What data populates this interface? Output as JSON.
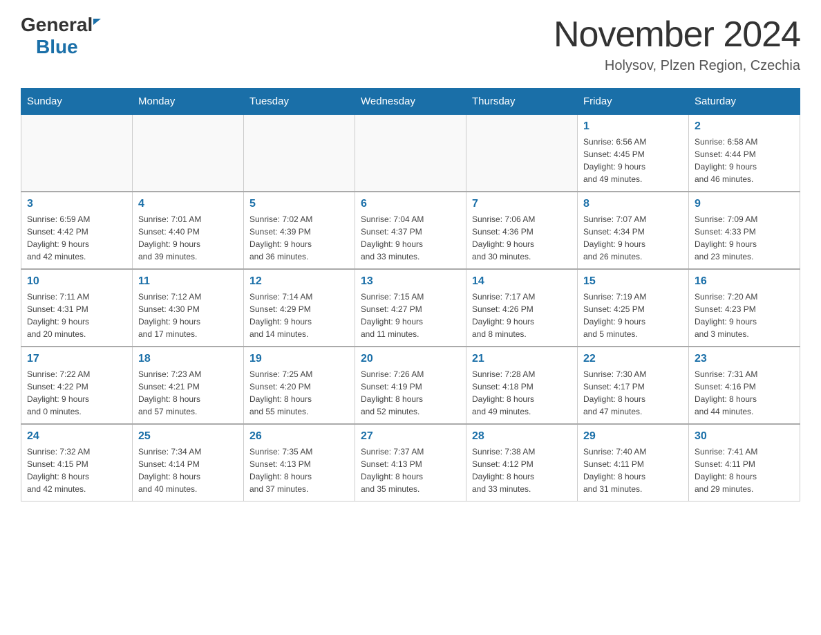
{
  "header": {
    "logo_line1": "General",
    "logo_line2": "Blue",
    "month_title": "November 2024",
    "location": "Holysov, Plzen Region, Czechia"
  },
  "weekdays": [
    "Sunday",
    "Monday",
    "Tuesday",
    "Wednesday",
    "Thursday",
    "Friday",
    "Saturday"
  ],
  "rows": [
    [
      {
        "day": "",
        "info": ""
      },
      {
        "day": "",
        "info": ""
      },
      {
        "day": "",
        "info": ""
      },
      {
        "day": "",
        "info": ""
      },
      {
        "day": "",
        "info": ""
      },
      {
        "day": "1",
        "info": "Sunrise: 6:56 AM\nSunset: 4:45 PM\nDaylight: 9 hours\nand 49 minutes."
      },
      {
        "day": "2",
        "info": "Sunrise: 6:58 AM\nSunset: 4:44 PM\nDaylight: 9 hours\nand 46 minutes."
      }
    ],
    [
      {
        "day": "3",
        "info": "Sunrise: 6:59 AM\nSunset: 4:42 PM\nDaylight: 9 hours\nand 42 minutes."
      },
      {
        "day": "4",
        "info": "Sunrise: 7:01 AM\nSunset: 4:40 PM\nDaylight: 9 hours\nand 39 minutes."
      },
      {
        "day": "5",
        "info": "Sunrise: 7:02 AM\nSunset: 4:39 PM\nDaylight: 9 hours\nand 36 minutes."
      },
      {
        "day": "6",
        "info": "Sunrise: 7:04 AM\nSunset: 4:37 PM\nDaylight: 9 hours\nand 33 minutes."
      },
      {
        "day": "7",
        "info": "Sunrise: 7:06 AM\nSunset: 4:36 PM\nDaylight: 9 hours\nand 30 minutes."
      },
      {
        "day": "8",
        "info": "Sunrise: 7:07 AM\nSunset: 4:34 PM\nDaylight: 9 hours\nand 26 minutes."
      },
      {
        "day": "9",
        "info": "Sunrise: 7:09 AM\nSunset: 4:33 PM\nDaylight: 9 hours\nand 23 minutes."
      }
    ],
    [
      {
        "day": "10",
        "info": "Sunrise: 7:11 AM\nSunset: 4:31 PM\nDaylight: 9 hours\nand 20 minutes."
      },
      {
        "day": "11",
        "info": "Sunrise: 7:12 AM\nSunset: 4:30 PM\nDaylight: 9 hours\nand 17 minutes."
      },
      {
        "day": "12",
        "info": "Sunrise: 7:14 AM\nSunset: 4:29 PM\nDaylight: 9 hours\nand 14 minutes."
      },
      {
        "day": "13",
        "info": "Sunrise: 7:15 AM\nSunset: 4:27 PM\nDaylight: 9 hours\nand 11 minutes."
      },
      {
        "day": "14",
        "info": "Sunrise: 7:17 AM\nSunset: 4:26 PM\nDaylight: 9 hours\nand 8 minutes."
      },
      {
        "day": "15",
        "info": "Sunrise: 7:19 AM\nSunset: 4:25 PM\nDaylight: 9 hours\nand 5 minutes."
      },
      {
        "day": "16",
        "info": "Sunrise: 7:20 AM\nSunset: 4:23 PM\nDaylight: 9 hours\nand 3 minutes."
      }
    ],
    [
      {
        "day": "17",
        "info": "Sunrise: 7:22 AM\nSunset: 4:22 PM\nDaylight: 9 hours\nand 0 minutes."
      },
      {
        "day": "18",
        "info": "Sunrise: 7:23 AM\nSunset: 4:21 PM\nDaylight: 8 hours\nand 57 minutes."
      },
      {
        "day": "19",
        "info": "Sunrise: 7:25 AM\nSunset: 4:20 PM\nDaylight: 8 hours\nand 55 minutes."
      },
      {
        "day": "20",
        "info": "Sunrise: 7:26 AM\nSunset: 4:19 PM\nDaylight: 8 hours\nand 52 minutes."
      },
      {
        "day": "21",
        "info": "Sunrise: 7:28 AM\nSunset: 4:18 PM\nDaylight: 8 hours\nand 49 minutes."
      },
      {
        "day": "22",
        "info": "Sunrise: 7:30 AM\nSunset: 4:17 PM\nDaylight: 8 hours\nand 47 minutes."
      },
      {
        "day": "23",
        "info": "Sunrise: 7:31 AM\nSunset: 4:16 PM\nDaylight: 8 hours\nand 44 minutes."
      }
    ],
    [
      {
        "day": "24",
        "info": "Sunrise: 7:32 AM\nSunset: 4:15 PM\nDaylight: 8 hours\nand 42 minutes."
      },
      {
        "day": "25",
        "info": "Sunrise: 7:34 AM\nSunset: 4:14 PM\nDaylight: 8 hours\nand 40 minutes."
      },
      {
        "day": "26",
        "info": "Sunrise: 7:35 AM\nSunset: 4:13 PM\nDaylight: 8 hours\nand 37 minutes."
      },
      {
        "day": "27",
        "info": "Sunrise: 7:37 AM\nSunset: 4:13 PM\nDaylight: 8 hours\nand 35 minutes."
      },
      {
        "day": "28",
        "info": "Sunrise: 7:38 AM\nSunset: 4:12 PM\nDaylight: 8 hours\nand 33 minutes."
      },
      {
        "day": "29",
        "info": "Sunrise: 7:40 AM\nSunset: 4:11 PM\nDaylight: 8 hours\nand 31 minutes."
      },
      {
        "day": "30",
        "info": "Sunrise: 7:41 AM\nSunset: 4:11 PM\nDaylight: 8 hours\nand 29 minutes."
      }
    ]
  ]
}
